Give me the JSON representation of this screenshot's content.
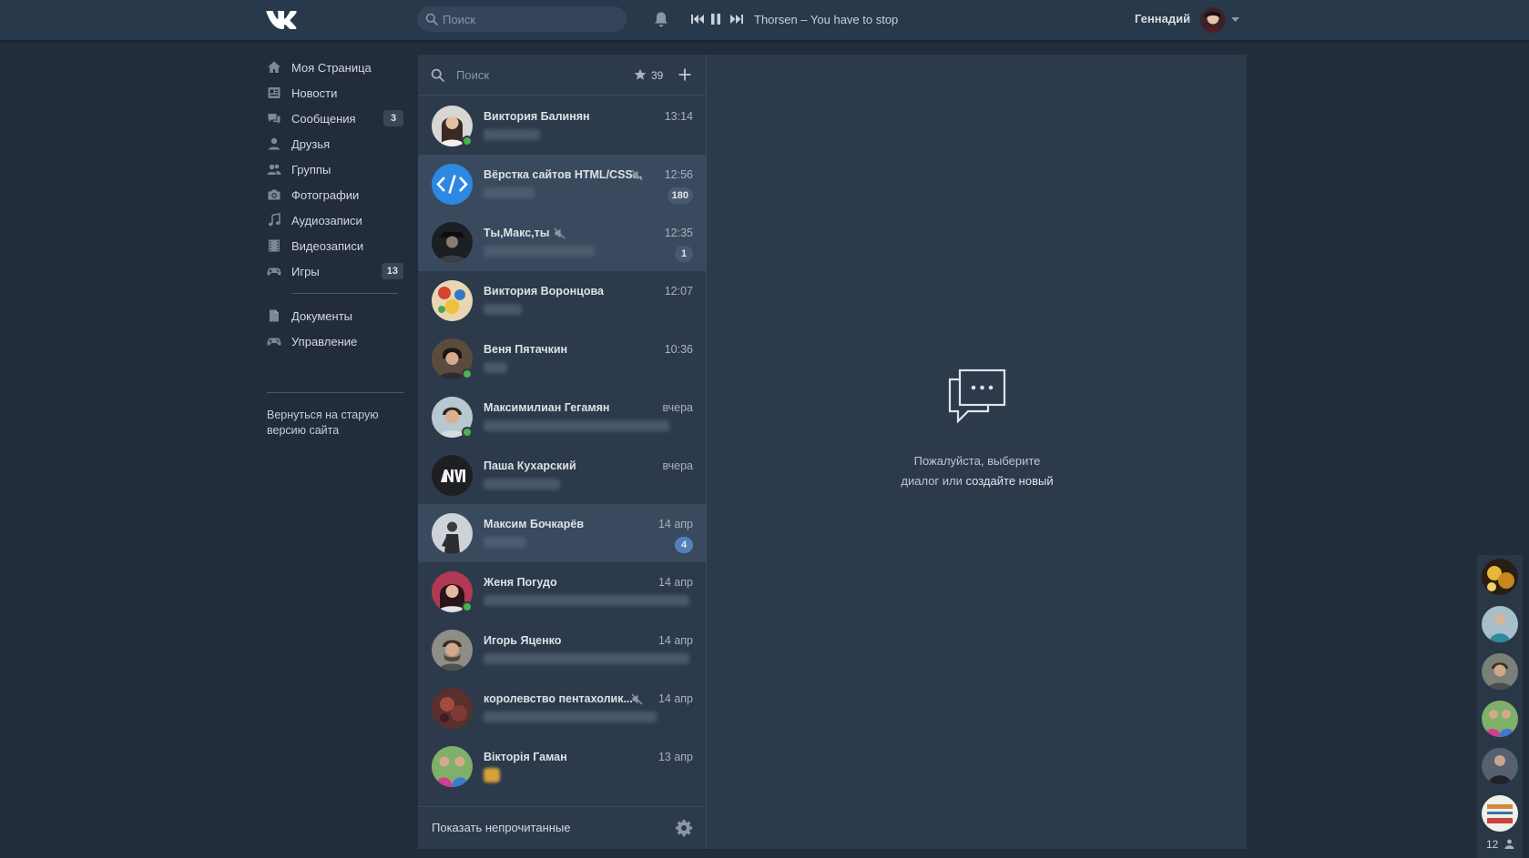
{
  "header": {
    "logo": "vk-logo",
    "search_placeholder": "Поиск",
    "player": {
      "track": "Thorsen – You have to stop"
    },
    "user": {
      "name": "Геннадий"
    }
  },
  "nav": {
    "items": [
      {
        "label": "Моя Страница",
        "icon": "home-icon"
      },
      {
        "label": "Новости",
        "icon": "news-icon"
      },
      {
        "label": "Сообщения",
        "icon": "messages-icon",
        "badge": "3"
      },
      {
        "label": "Друзья",
        "icon": "friends-icon"
      },
      {
        "label": "Группы",
        "icon": "groups-icon"
      },
      {
        "label": "Фотографии",
        "icon": "camera-icon"
      },
      {
        "label": "Аудиозаписи",
        "icon": "music-icon"
      },
      {
        "label": "Видеозаписи",
        "icon": "video-icon"
      },
      {
        "label": "Игры",
        "icon": "gamepad-icon",
        "badge": "13"
      }
    ],
    "extra": [
      {
        "label": "Документы",
        "icon": "document-icon"
      },
      {
        "label": "Управление",
        "icon": "gamepad-icon"
      }
    ],
    "old_site": "Вернуться на старую версию сайта"
  },
  "dialogs": {
    "search_placeholder": "Поиск",
    "important_count": "39",
    "list": [
      {
        "name": "Виктория Балинян",
        "time": "13:14",
        "online": true
      },
      {
        "name": "Вёрстка сайтов HTML/CSS...",
        "time": "12:56",
        "muted": true,
        "unread": "180",
        "active": true
      },
      {
        "name": "Ты,Макс,ты",
        "time": "12:35",
        "muted": true,
        "unread": "1",
        "active": true
      },
      {
        "name": "Виктория Воронцова",
        "time": "12:07"
      },
      {
        "name": "Веня Пятачкин",
        "time": "10:36",
        "online": true
      },
      {
        "name": "Максимилиан Гегамян",
        "time": "вчера",
        "online": true
      },
      {
        "name": "Паша Кухарский",
        "time": "вчера"
      },
      {
        "name": "Максим Бочкарёв",
        "time": "14 апр",
        "unread": "4",
        "active": true,
        "unread_blue": true
      },
      {
        "name": "Женя Погудо",
        "time": "14 апр",
        "online": true
      },
      {
        "name": "Игорь Яценко",
        "time": "14 апр"
      },
      {
        "name": "королевство пентахолик...",
        "time": "14 апр",
        "muted": true
      },
      {
        "name": "Вікторія Гаман",
        "time": "13 апр",
        "sticker": true
      }
    ],
    "show_unread": "Показать непрочитанные"
  },
  "conversation": {
    "hint_line1": "Пожалуйста, выберите",
    "hint_line2": "диалог или",
    "create_link": "создайте новый"
  },
  "friends_strip": {
    "count": "12"
  },
  "colors": {
    "bg": "#222c3a",
    "panel": "#2c3a4c",
    "header": "#29394c",
    "active_row": "#3a4a5e",
    "online": "#4bb34b",
    "unread_blue": "#5181b8"
  }
}
